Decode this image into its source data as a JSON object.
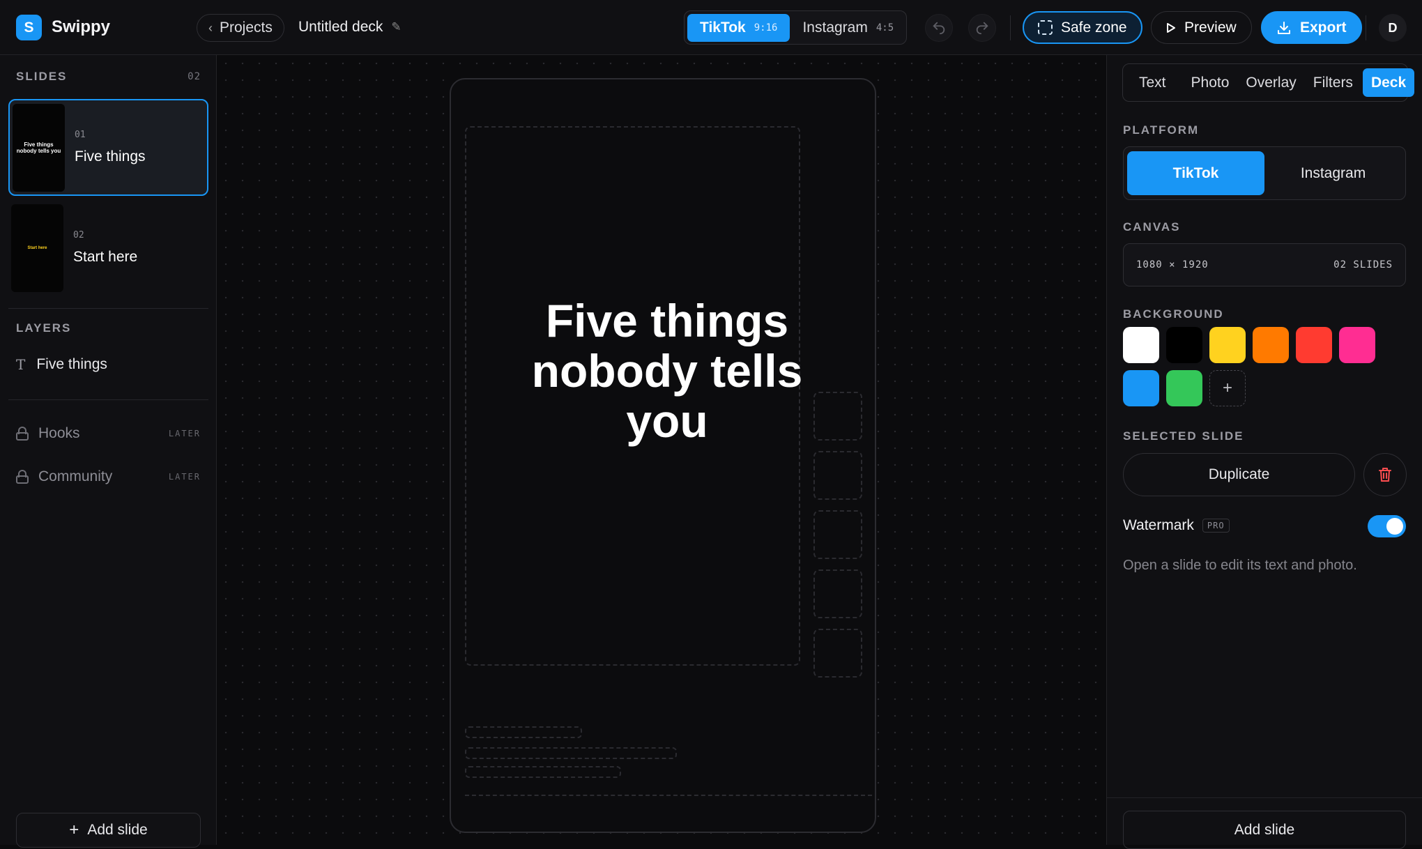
{
  "app": {
    "logo_letter": "S",
    "brand": "Swippy",
    "accent": "#1996f5"
  },
  "header": {
    "projects_label": "Projects",
    "deck_title": "Untitled deck",
    "platforms": [
      {
        "label": "TikTok",
        "ratio": "9:16",
        "active": true
      },
      {
        "label": "Instagram",
        "ratio": "4:5",
        "active": false
      }
    ],
    "undo_icon": "undo-icon",
    "redo_icon": "redo-icon",
    "safe_zone_label": "Safe zone",
    "preview_label": "Preview",
    "export_label": "Export",
    "avatar_letter": "D"
  },
  "sidebar": {
    "slides_title": "SLIDES",
    "slides_count": "02",
    "slides": [
      {
        "num": "01",
        "name": "Five things",
        "thumb_text": "Five things nobody tells you",
        "selected": true
      },
      {
        "num": "02",
        "name": "Start here",
        "thumb_text": "Start here",
        "selected": false
      }
    ],
    "layers_title": "LAYERS",
    "layers": [
      {
        "icon": "text-icon",
        "name": "Five things"
      }
    ],
    "locked": [
      {
        "name": "Hooks",
        "badge": "LATER"
      },
      {
        "name": "Community",
        "badge": "LATER"
      }
    ],
    "add_slide_label": "Add slide"
  },
  "canvas": {
    "headline": "Five things nobody tells you"
  },
  "panel": {
    "tabs": [
      {
        "label": "Text",
        "active": false
      },
      {
        "label": "Photo",
        "active": false
      },
      {
        "label": "Overlay",
        "active": false
      },
      {
        "label": "Filters",
        "active": false
      },
      {
        "label": "Deck",
        "active": true
      }
    ],
    "platform_title": "PLATFORM",
    "platform_options": [
      {
        "label": "TikTok",
        "active": true
      },
      {
        "label": "Instagram",
        "active": false
      }
    ],
    "canvas_title": "CANVAS",
    "canvas_size": "1080 × 1920",
    "canvas_slides": "02 SLIDES",
    "background_title": "BACKGROUND",
    "background_colors": [
      "#ffffff",
      "#000000",
      "#ffd21f",
      "#ff7a00",
      "#ff3b30",
      "#ff2d92",
      "#1996f5",
      "#34c759"
    ],
    "selected_title": "SELECTED SLIDE",
    "duplicate_label": "Duplicate",
    "watermark_label": "Watermark",
    "watermark_badge": "PRO",
    "watermark_on": true,
    "hint": "Open a slide to edit its text and photo.",
    "add_slide_label": "Add slide"
  }
}
